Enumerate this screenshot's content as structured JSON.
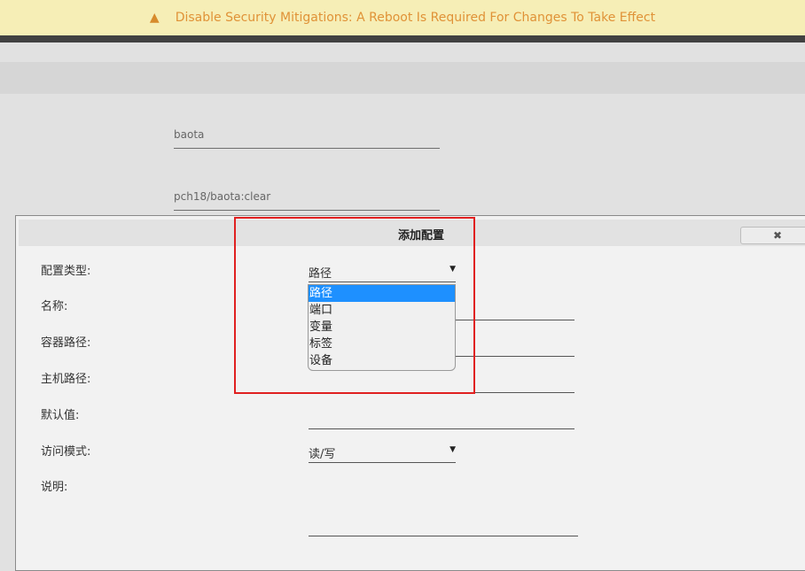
{
  "banner": {
    "icon": "warning-icon",
    "text": "Disable Security Mitigations: A Reboot Is Required For Changes To Take Effect",
    "color": "#e09237"
  },
  "background_form": {
    "name_value": "baota",
    "repo_value": "pch18/baota:clear"
  },
  "dialog": {
    "title": "添加配置",
    "close_label": "✖",
    "labels": {
      "config_type": "配置类型:",
      "name": "名称:",
      "container_path": "容器路径:",
      "host_path": "主机路径:",
      "default_value": "默认值:",
      "access_mode": "访问模式:",
      "description": "说明:"
    },
    "config_type_value": "路径",
    "access_mode_value": "读/写",
    "config_type_options": [
      "路径",
      "端口",
      "变量",
      "标签",
      "设备"
    ]
  },
  "colors": {
    "highlight": "#1e90ff",
    "annotation": "#e02020"
  }
}
